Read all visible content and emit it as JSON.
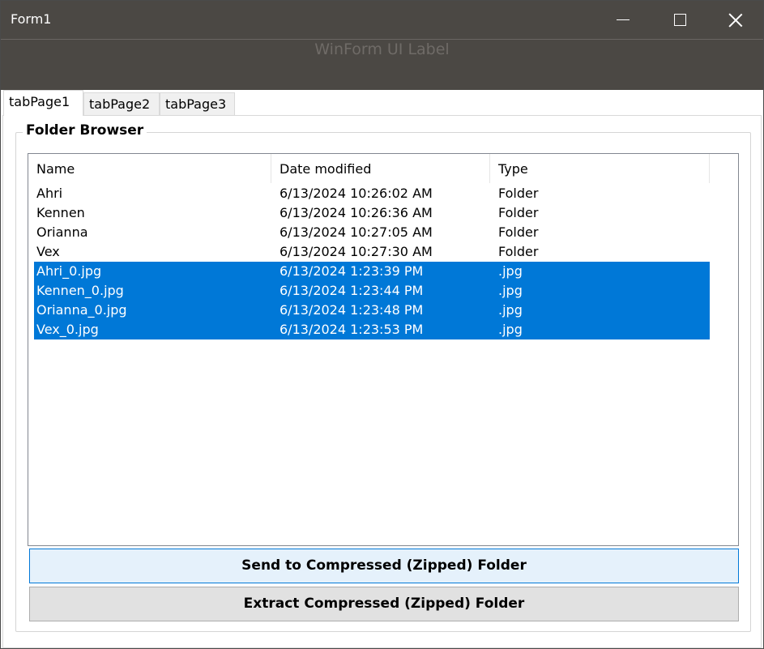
{
  "window": {
    "title": "Form1"
  },
  "header": {
    "label": "WinForm UI Label"
  },
  "tabs": [
    {
      "label": "tabPage1",
      "active": true
    },
    {
      "label": "tabPage2",
      "active": false
    },
    {
      "label": "tabPage3",
      "active": false
    }
  ],
  "groupbox": {
    "title": "Folder Browser"
  },
  "listview": {
    "columns": [
      "Name",
      "Date modified",
      "Type"
    ],
    "rows": [
      {
        "name": "Ahri",
        "date": "6/13/2024 10:26:02 AM",
        "type": "Folder",
        "selected": false
      },
      {
        "name": "Kennen",
        "date": "6/13/2024 10:26:36 AM",
        "type": "Folder",
        "selected": false
      },
      {
        "name": "Orianna",
        "date": "6/13/2024 10:27:05 AM",
        "type": "Folder",
        "selected": false
      },
      {
        "name": "Vex",
        "date": "6/13/2024 10:27:30 AM",
        "type": "Folder",
        "selected": false
      },
      {
        "name": "Ahri_0.jpg",
        "date": "6/13/2024 1:23:39 PM",
        "type": ".jpg",
        "selected": true
      },
      {
        "name": "Kennen_0.jpg",
        "date": "6/13/2024 1:23:44 PM",
        "type": ".jpg",
        "selected": true
      },
      {
        "name": "Orianna_0.jpg",
        "date": "6/13/2024 1:23:48 PM",
        "type": ".jpg",
        "selected": true
      },
      {
        "name": "Vex_0.jpg",
        "date": "6/13/2024 1:23:53 PM",
        "type": ".jpg",
        "selected": true
      }
    ]
  },
  "buttons": {
    "send_label": "Send to Compressed (Zipped) Folder",
    "extract_label": "Extract Compressed (Zipped) Folder"
  },
  "colors": {
    "titlebar_bg": "#4b4844",
    "selection": "#0078d7",
    "focused_button_bg": "#e5f1fb"
  },
  "icons": {
    "minimize": "minimize-icon",
    "maximize": "maximize-icon",
    "close": "close-icon"
  }
}
